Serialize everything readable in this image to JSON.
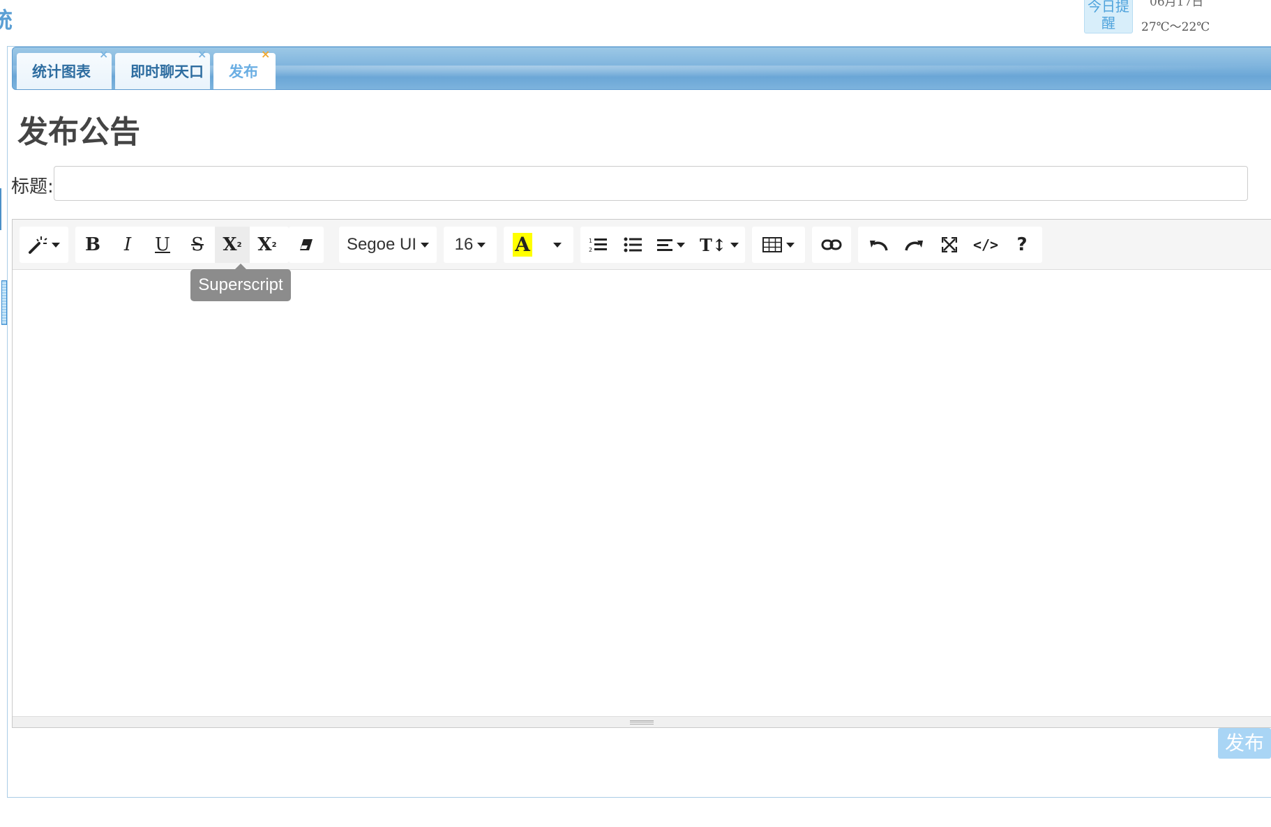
{
  "header": {
    "app_title_fragment": "统",
    "reminder_label": "今日提醒",
    "date": "06月17日",
    "weather": "27℃～22℃"
  },
  "tabs": [
    {
      "label": "统计图表",
      "active": false,
      "close": "×"
    },
    {
      "label": "即时聊天口",
      "active": false,
      "close": "×"
    },
    {
      "label": "发布",
      "active": true,
      "close": "×"
    }
  ],
  "page": {
    "title": "发布公告",
    "title_field_label": "标题:",
    "title_field_value": "",
    "publish_button": "发布"
  },
  "editor": {
    "toolbar": {
      "style_icon": "magic-wand-icon",
      "bold": "B",
      "italic": "I",
      "underline": "U",
      "strikethrough": "S",
      "superscript": "X",
      "subscript": "X",
      "font_family": "Segoe UI",
      "font_size": "16",
      "text_color": "A",
      "text_color_swatch": "#ffff00",
      "line_height": "T↕",
      "code_view": "</>",
      "help": "?"
    },
    "tooltip": "Superscript",
    "content": ""
  }
}
